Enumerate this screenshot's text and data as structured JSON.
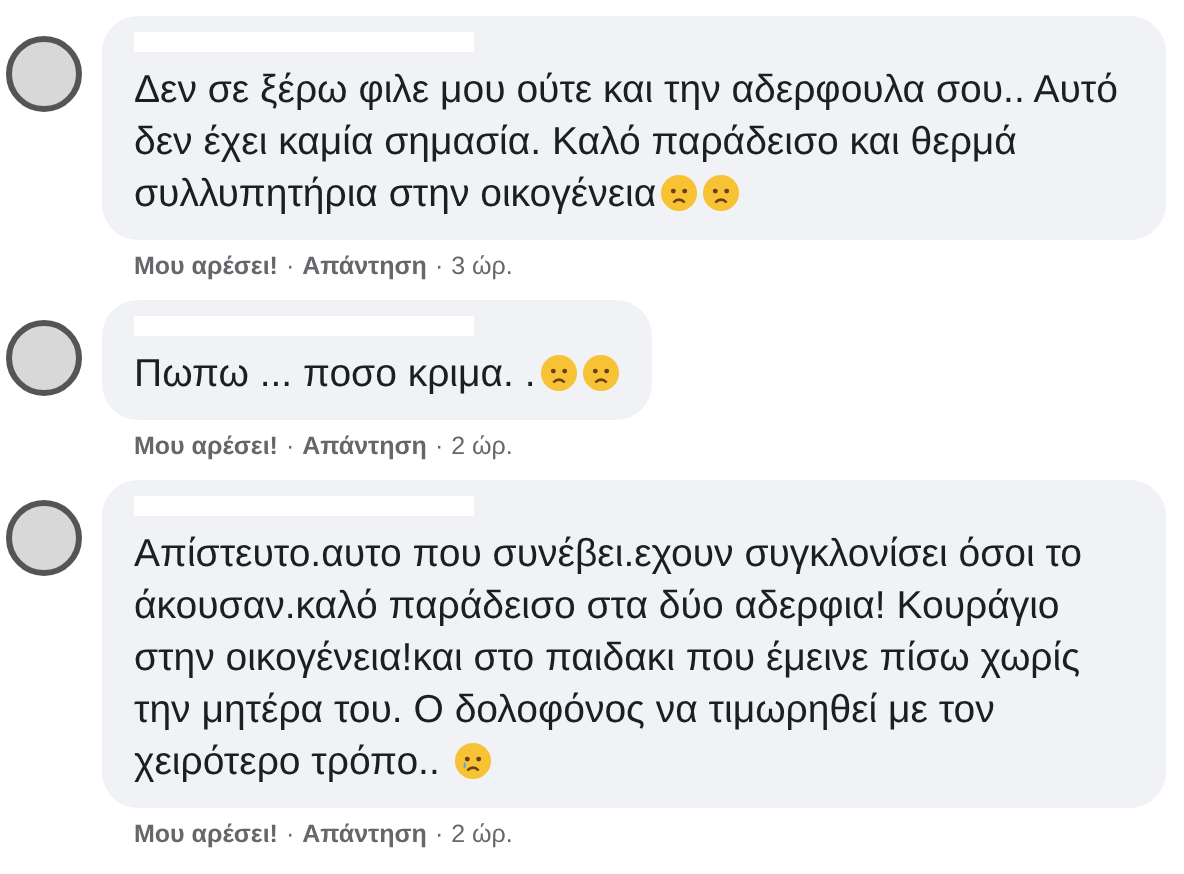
{
  "comments": [
    {
      "text": "Δεν σε ξέρω φιλε μου ούτε και την αδερφουλα σου.. Αυτό δεν έχει καμία σημασία. Καλό παράδεισο και θερμά συλλυπητήρια στην οικογένεια",
      "emojis": [
        {
          "kind": "sad"
        },
        {
          "kind": "sad"
        }
      ],
      "like": "Μου αρέσει!",
      "sep": "·",
      "reply": "Απάντηση",
      "sep2": "·",
      "time": "3 ώρ."
    },
    {
      "text": "Πωπω ... ποσο κριμα. .",
      "emojis": [
        {
          "kind": "sad"
        },
        {
          "kind": "sad"
        }
      ],
      "like": "Μου αρέσει!",
      "sep": "·",
      "reply": "Απάντηση",
      "sep2": "·",
      "time": "2 ώρ."
    },
    {
      "text": "Απίστευτο.αυτο που συνέβει.εχουν συγκλονίσει όσοι το άκουσαν.καλό παράδεισο στα δύο αδερφια! Κουράγιο στην οικογένεια!και στο παιδακι που έμεινε πίσω χωρίς την μητέρα του. Ο δολοφόνος να τιμωρηθεί με τον χειρότερο τρόπο.. ",
      "emojis": [
        {
          "kind": "crying"
        }
      ],
      "like": "Μου αρέσει!",
      "sep": "·",
      "reply": "Απάντηση",
      "sep2": "·",
      "time": "2 ώρ."
    }
  ]
}
